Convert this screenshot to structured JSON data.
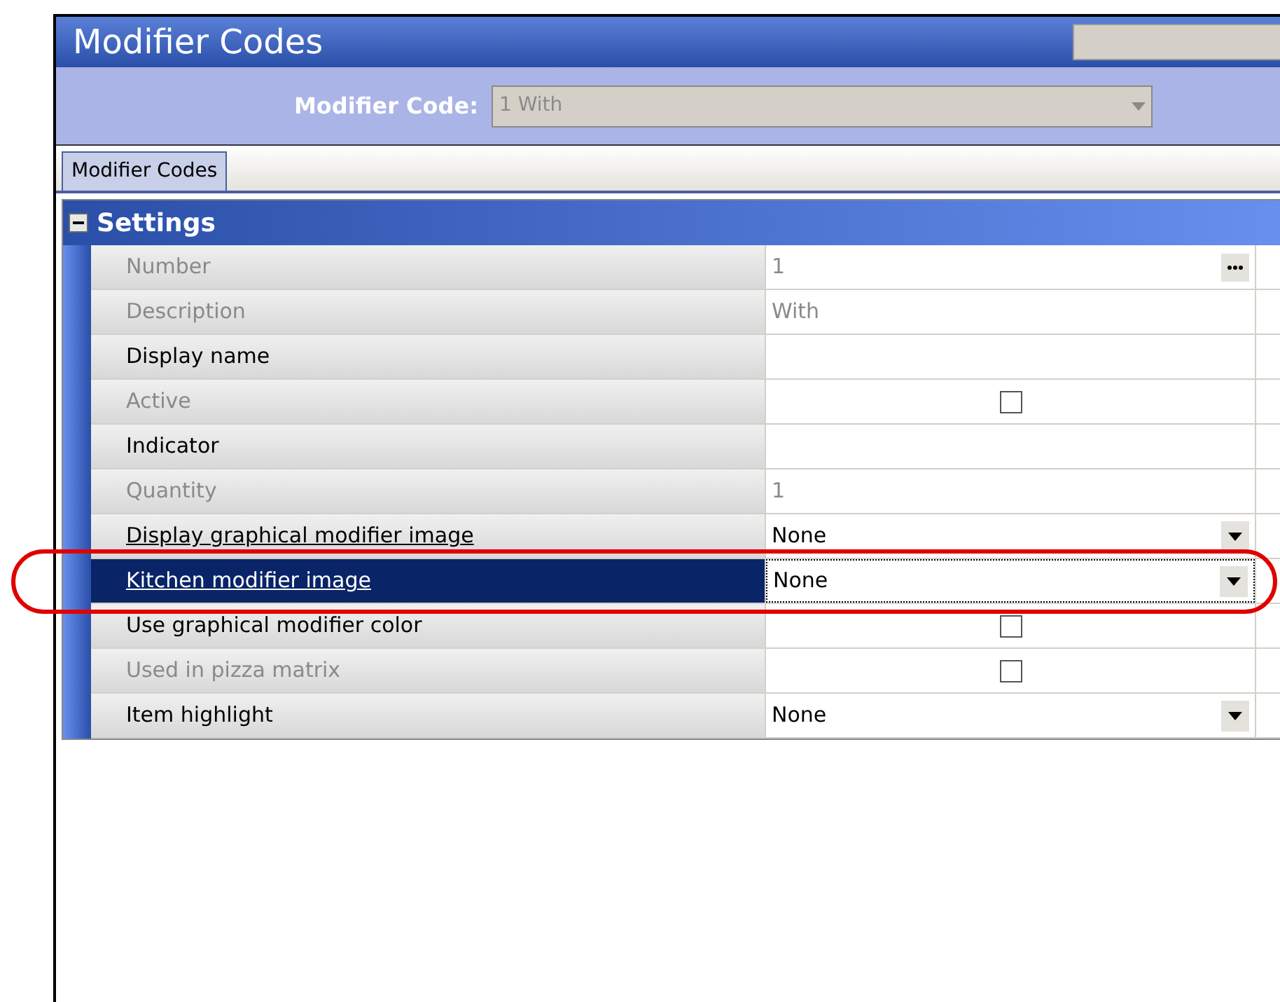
{
  "window": {
    "title": "Modifier Codes"
  },
  "selector": {
    "label": "Modifier Code:",
    "value": "1 With",
    "disabled": true
  },
  "tabs": [
    {
      "label": "Modifier Codes",
      "selected": true
    }
  ],
  "section": {
    "title": "Settings",
    "expanded": true
  },
  "rows": [
    {
      "label": "Number",
      "disabled": true,
      "selected": false,
      "underlined": false,
      "kind": "ellipsis",
      "value": "1"
    },
    {
      "label": "Description",
      "disabled": true,
      "selected": false,
      "underlined": false,
      "kind": "text",
      "value": "With"
    },
    {
      "label": "Display name",
      "disabled": false,
      "selected": false,
      "underlined": false,
      "kind": "text"
    },
    {
      "label": "Active",
      "disabled": true,
      "selected": false,
      "underlined": false,
      "kind": "checkbox",
      "checked": false
    },
    {
      "label": "Indicator",
      "disabled": false,
      "selected": false,
      "underlined": false,
      "kind": "text"
    },
    {
      "label": "Quantity",
      "disabled": true,
      "selected": false,
      "underlined": false,
      "kind": "text",
      "value": "1"
    },
    {
      "label": "Display graphical modifier image",
      "disabled": false,
      "selected": false,
      "underlined": true,
      "kind": "dropdown",
      "value": "None"
    },
    {
      "label": "Kitchen modifier image",
      "disabled": false,
      "selected": true,
      "underlined": true,
      "ringed": true,
      "kind": "dropdown",
      "value": "None"
    },
    {
      "label": "Use graphical modifier color",
      "disabled": false,
      "selected": false,
      "underlined": false,
      "kind": "checkbox",
      "checked": false
    },
    {
      "label": "Used in pizza matrix",
      "disabled": true,
      "selected": false,
      "underlined": false,
      "kind": "checkbox",
      "checked": false
    },
    {
      "label": "Item highlight",
      "disabled": false,
      "selected": false,
      "underlined": false,
      "kind": "dropdown",
      "value": "None"
    }
  ]
}
